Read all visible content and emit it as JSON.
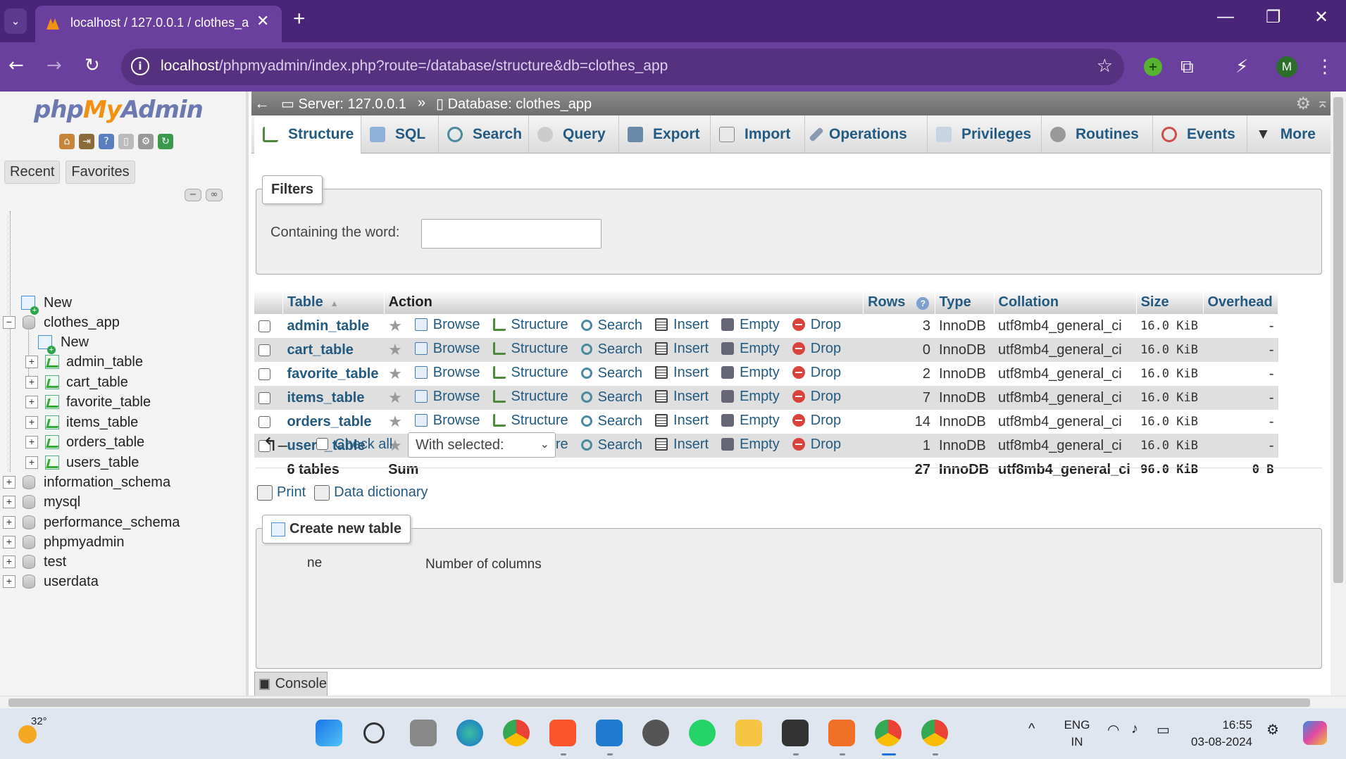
{
  "browser": {
    "tab_title": "localhost / 127.0.0.1 / clothes_a",
    "url_host": "localhost",
    "url_path": "/phpmyadmin/index.php?route=/database/structure&db=clothes_app",
    "profile_initial": "M"
  },
  "pma": {
    "logo_php": "php",
    "logo_my": "My",
    "logo_admin": "Admin",
    "recent_label": "Recent",
    "favorites_label": "Favorites",
    "tree": {
      "new_root": "New",
      "current_db": "clothes_app",
      "new_table": "New",
      "tables": [
        "admin_table",
        "cart_table",
        "favorite_table",
        "items_table",
        "orders_table",
        "users_table"
      ],
      "other_dbs": [
        "information_schema",
        "mysql",
        "performance_schema",
        "phpmyadmin",
        "test",
        "userdata"
      ]
    },
    "breadcrumb": {
      "server": "Server: 127.0.0.1",
      "separator": "»",
      "database": "Database: clothes_app"
    },
    "menu_tabs": [
      {
        "label": "Structure",
        "icon": "structure-icon",
        "active": true
      },
      {
        "label": "SQL",
        "icon": "sql-icon"
      },
      {
        "label": "Search",
        "icon": "search-icon"
      },
      {
        "label": "Query",
        "icon": "query-icon"
      },
      {
        "label": "Export",
        "icon": "export-icon"
      },
      {
        "label": "Import",
        "icon": "import-icon"
      },
      {
        "label": "Operations",
        "icon": "wrench-icon"
      },
      {
        "label": "Privileges",
        "icon": "privileges-icon"
      },
      {
        "label": "Routines",
        "icon": "routines-icon"
      },
      {
        "label": "Events",
        "icon": "clock-icon"
      },
      {
        "label": "More",
        "icon": "chevron-down-icon"
      }
    ],
    "filters": {
      "legend": "Filters",
      "label": "Containing the word:",
      "value": ""
    },
    "table": {
      "headers": {
        "table": "Table",
        "action": "Action",
        "rows": "Rows",
        "type": "Type",
        "collation": "Collation",
        "size": "Size",
        "overhead": "Overhead"
      },
      "actions": [
        "Browse",
        "Structure",
        "Search",
        "Insert",
        "Empty",
        "Drop"
      ],
      "rows": [
        {
          "name": "admin_table",
          "rows": "3",
          "type": "InnoDB",
          "collation": "utf8mb4_general_ci",
          "size": "16.0 KiB",
          "overhead": "-"
        },
        {
          "name": "cart_table",
          "rows": "0",
          "type": "InnoDB",
          "collation": "utf8mb4_general_ci",
          "size": "16.0 KiB",
          "overhead": "-"
        },
        {
          "name": "favorite_table",
          "rows": "2",
          "type": "InnoDB",
          "collation": "utf8mb4_general_ci",
          "size": "16.0 KiB",
          "overhead": "-"
        },
        {
          "name": "items_table",
          "rows": "7",
          "type": "InnoDB",
          "collation": "utf8mb4_general_ci",
          "size": "16.0 KiB",
          "overhead": "-"
        },
        {
          "name": "orders_table",
          "rows": "14",
          "type": "InnoDB",
          "collation": "utf8mb4_general_ci",
          "size": "16.0 KiB",
          "overhead": "-"
        },
        {
          "name": "users_table",
          "rows": "1",
          "type": "InnoDB",
          "collation": "utf8mb4_general_ci",
          "size": "16.0 KiB",
          "overhead": "-"
        }
      ],
      "total": {
        "tables": "6 tables",
        "sum": "Sum",
        "rows": "27",
        "type": "InnoDB",
        "collation": "utf8mb4_general_ci",
        "size": "96.0 KiB",
        "overhead": "0 B"
      }
    },
    "bulk": {
      "check_all": "Check all",
      "with_selected": "With selected:"
    },
    "print_label": "Print",
    "data_dictionary_label": "Data dictionary",
    "create_table": {
      "legend": "Create new table",
      "name_label_partial": "ne",
      "columns_label": "Number of columns"
    },
    "console_label": "Console"
  },
  "taskbar": {
    "temperature": "32°",
    "lang_top": "ENG",
    "lang_bottom": "IN",
    "time": "16:55",
    "date": "03-08-2024"
  },
  "colors": {
    "chrome_tab_bar": "#4a2479",
    "chrome_toolbar": "#6a3f9e",
    "pma_link": "#235a81",
    "row_alt": "#dfdfdf"
  }
}
